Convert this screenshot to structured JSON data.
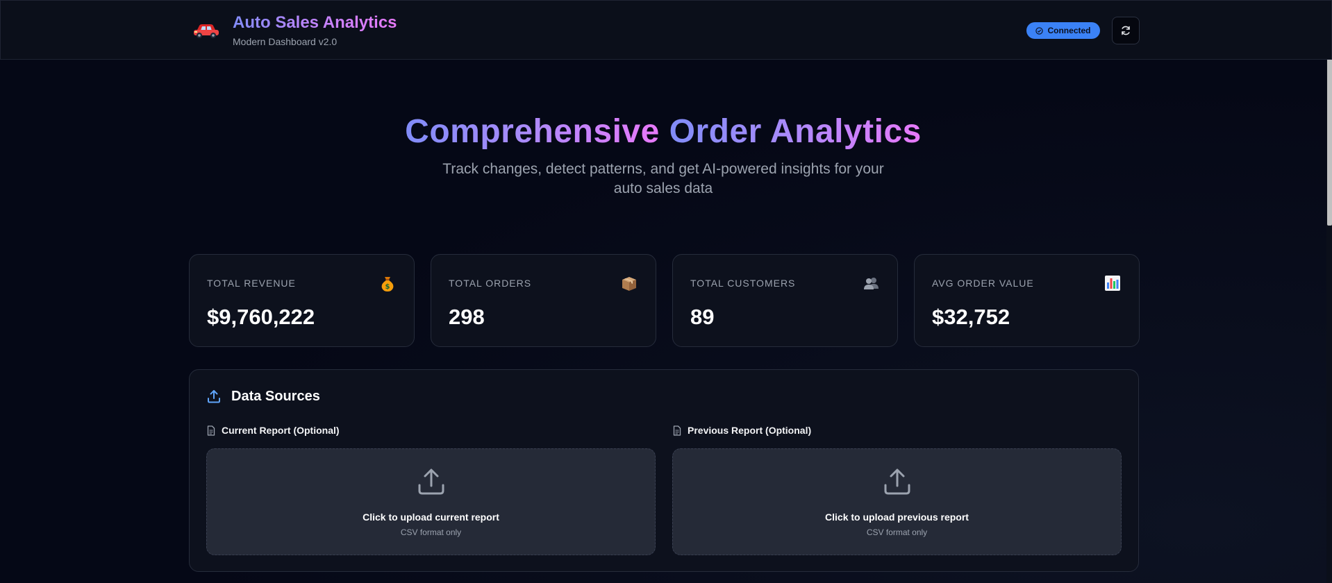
{
  "header": {
    "title": "Auto Sales Analytics",
    "subtitle": "Modern Dashboard v2.0",
    "status": "Connected",
    "logo_icon": "car-icon",
    "refresh_icon": "refresh-icon"
  },
  "hero": {
    "title_part1": "Comprehensive",
    "title_part2": "Order Analytics",
    "subtitle": "Track changes, detect patterns, and get AI-powered insights for your auto sales data"
  },
  "stats": [
    {
      "label": "TOTAL REVENUE",
      "value": "$9,760,222",
      "icon": "money-bag-icon"
    },
    {
      "label": "TOTAL ORDERS",
      "value": "298",
      "icon": "package-icon"
    },
    {
      "label": "TOTAL CUSTOMERS",
      "value": "89",
      "icon": "users-icon"
    },
    {
      "label": "AVG ORDER VALUE",
      "value": "$32,752",
      "icon": "bar-chart-icon"
    }
  ],
  "sources": {
    "title": "Data Sources",
    "current": {
      "label": "Current Report (Optional)",
      "upload_title": "Click to upload current report",
      "upload_sub": "CSV format only"
    },
    "previous": {
      "label": "Previous Report (Optional)",
      "upload_title": "Click to upload previous report",
      "upload_sub": "CSV format only"
    }
  },
  "colors": {
    "background": "#050816",
    "accent": "#3b82f6",
    "gradient_start": "#818cf8",
    "gradient_end": "#e879f9"
  }
}
